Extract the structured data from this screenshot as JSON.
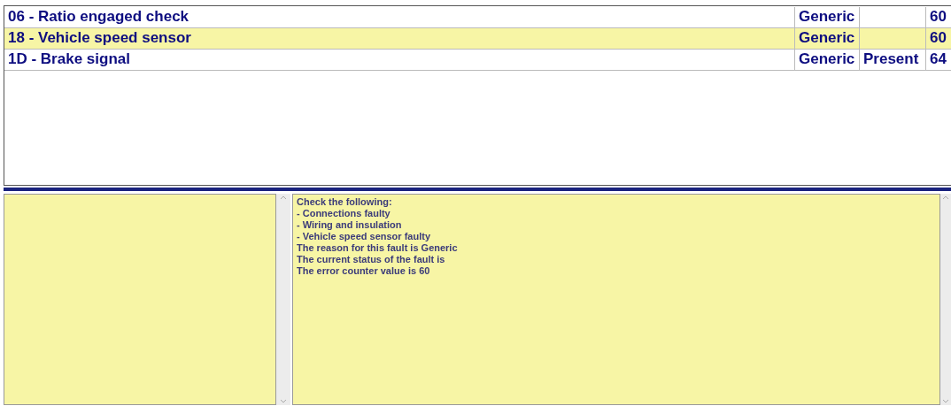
{
  "faults": [
    {
      "code_description": "06 - Ratio engaged check",
      "reason": "Generic",
      "counter": "60",
      "selected": false
    },
    {
      "code_description": "18 - Vehicle speed sensor",
      "reason": "Generic",
      "counter": "60",
      "selected": true
    },
    {
      "code_description": "1D - Brake signal",
      "reason": "Generic",
      "status": "Present",
      "counter": "64",
      "selected": false
    }
  ],
  "details": {
    "lines": [
      "Check the following:",
      "- Connections faulty",
      "- Wiring and insulation",
      "- Vehicle speed sensor faulty",
      "The reason for this fault is Generic",
      "The current status of the fault is",
      "The error counter value is 60"
    ]
  }
}
